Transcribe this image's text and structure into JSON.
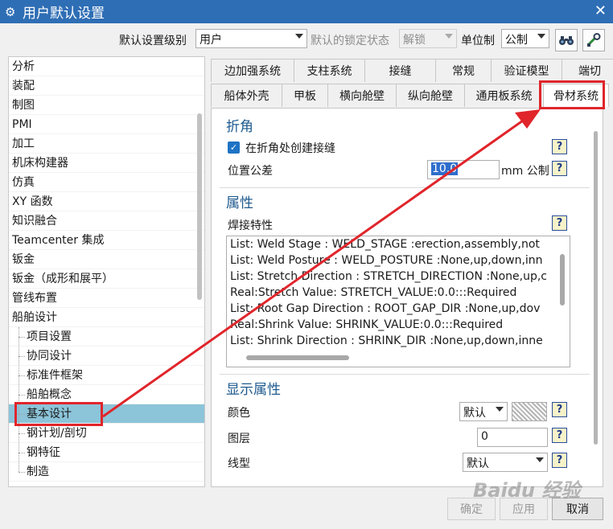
{
  "window": {
    "title": "用户默认设置",
    "colors": {
      "titlebar": "#2e6eb5",
      "accent": "#e0252b"
    }
  },
  "toolbar": {
    "level_label": "默认设置级别",
    "level_value": "用户",
    "lock_label": "默认的锁定状态",
    "lock_value": "解锁",
    "unit_label": "单位制",
    "unit_value": "公制",
    "icon1": "binoculars-icon",
    "icon2": "settings-wrench-icon"
  },
  "tree": {
    "items": [
      {
        "label": "分析",
        "child": false
      },
      {
        "label": "装配",
        "child": false
      },
      {
        "label": "制图",
        "child": false
      },
      {
        "label": "PMI",
        "child": false
      },
      {
        "label": "加工",
        "child": false
      },
      {
        "label": "机床构建器",
        "child": false
      },
      {
        "label": "仿真",
        "child": false
      },
      {
        "label": "XY 函数",
        "child": false
      },
      {
        "label": "知识融合",
        "child": false
      },
      {
        "label": "Teamcenter 集成",
        "child": false
      },
      {
        "label": "钣金",
        "child": false
      },
      {
        "label": "钣金（成形和展平）",
        "child": false
      },
      {
        "label": "管线布置",
        "child": false
      },
      {
        "label": "船舶设计",
        "child": false
      },
      {
        "label": "项目设置",
        "child": true
      },
      {
        "label": "协同设计",
        "child": true
      },
      {
        "label": "标准件框架",
        "child": true
      },
      {
        "label": "船舶概念",
        "child": true
      },
      {
        "label": "基本设计",
        "child": true,
        "selected": true
      },
      {
        "label": "钢计划/剖切",
        "child": true
      },
      {
        "label": "钢特征",
        "child": true
      },
      {
        "label": "制造",
        "child": true
      }
    ]
  },
  "tabs": {
    "row1": [
      "边加强系统",
      "支柱系统",
      "接缝",
      "常规",
      "验证模型",
      "端切"
    ],
    "row2": [
      "船体外壳",
      "甲板",
      "横向舱壁",
      "纵向舱壁",
      "通用板系统",
      "骨材系统"
    ]
  },
  "panel": {
    "fold_title": "折角",
    "fold_checkbox": "在折角处创建接缝",
    "position_tol_label": "位置公差",
    "position_tol_value": "10.0",
    "position_tol_unit": "mm 公制",
    "attributes_title": "属性",
    "weld_label": "焊接特性",
    "weld_list": [
      "List: Weld Stage : WELD_STAGE :erection,assembly,not",
      "List: Weld Posture : WELD_POSTURE :None,up,down,inn",
      "List: Stretch Direction : STRETCH_DIRECTION :None,up,c",
      "Real:Stretch Value: STRETCH_VALUE:0.0:::Required",
      "List: Root Gap Direction : ROOT_GAP_DIR :None,up,dov",
      "Real:Shrink Value: SHRINK_VALUE:0.0:::Required",
      "List: Shrink Direction : SHRINK_DIR :None,up,down,inne"
    ],
    "display_title": "显示属性",
    "color_label": "颜色",
    "color_value": "默认",
    "layer_label": "图层",
    "layer_value": "0",
    "linetype_label": "线型",
    "linetype_value": "默认",
    "help_glyph": "?"
  },
  "footer": {
    "ok": "确定",
    "apply": "应用",
    "cancel": "取消"
  },
  "watermark": "Baidu 经验"
}
